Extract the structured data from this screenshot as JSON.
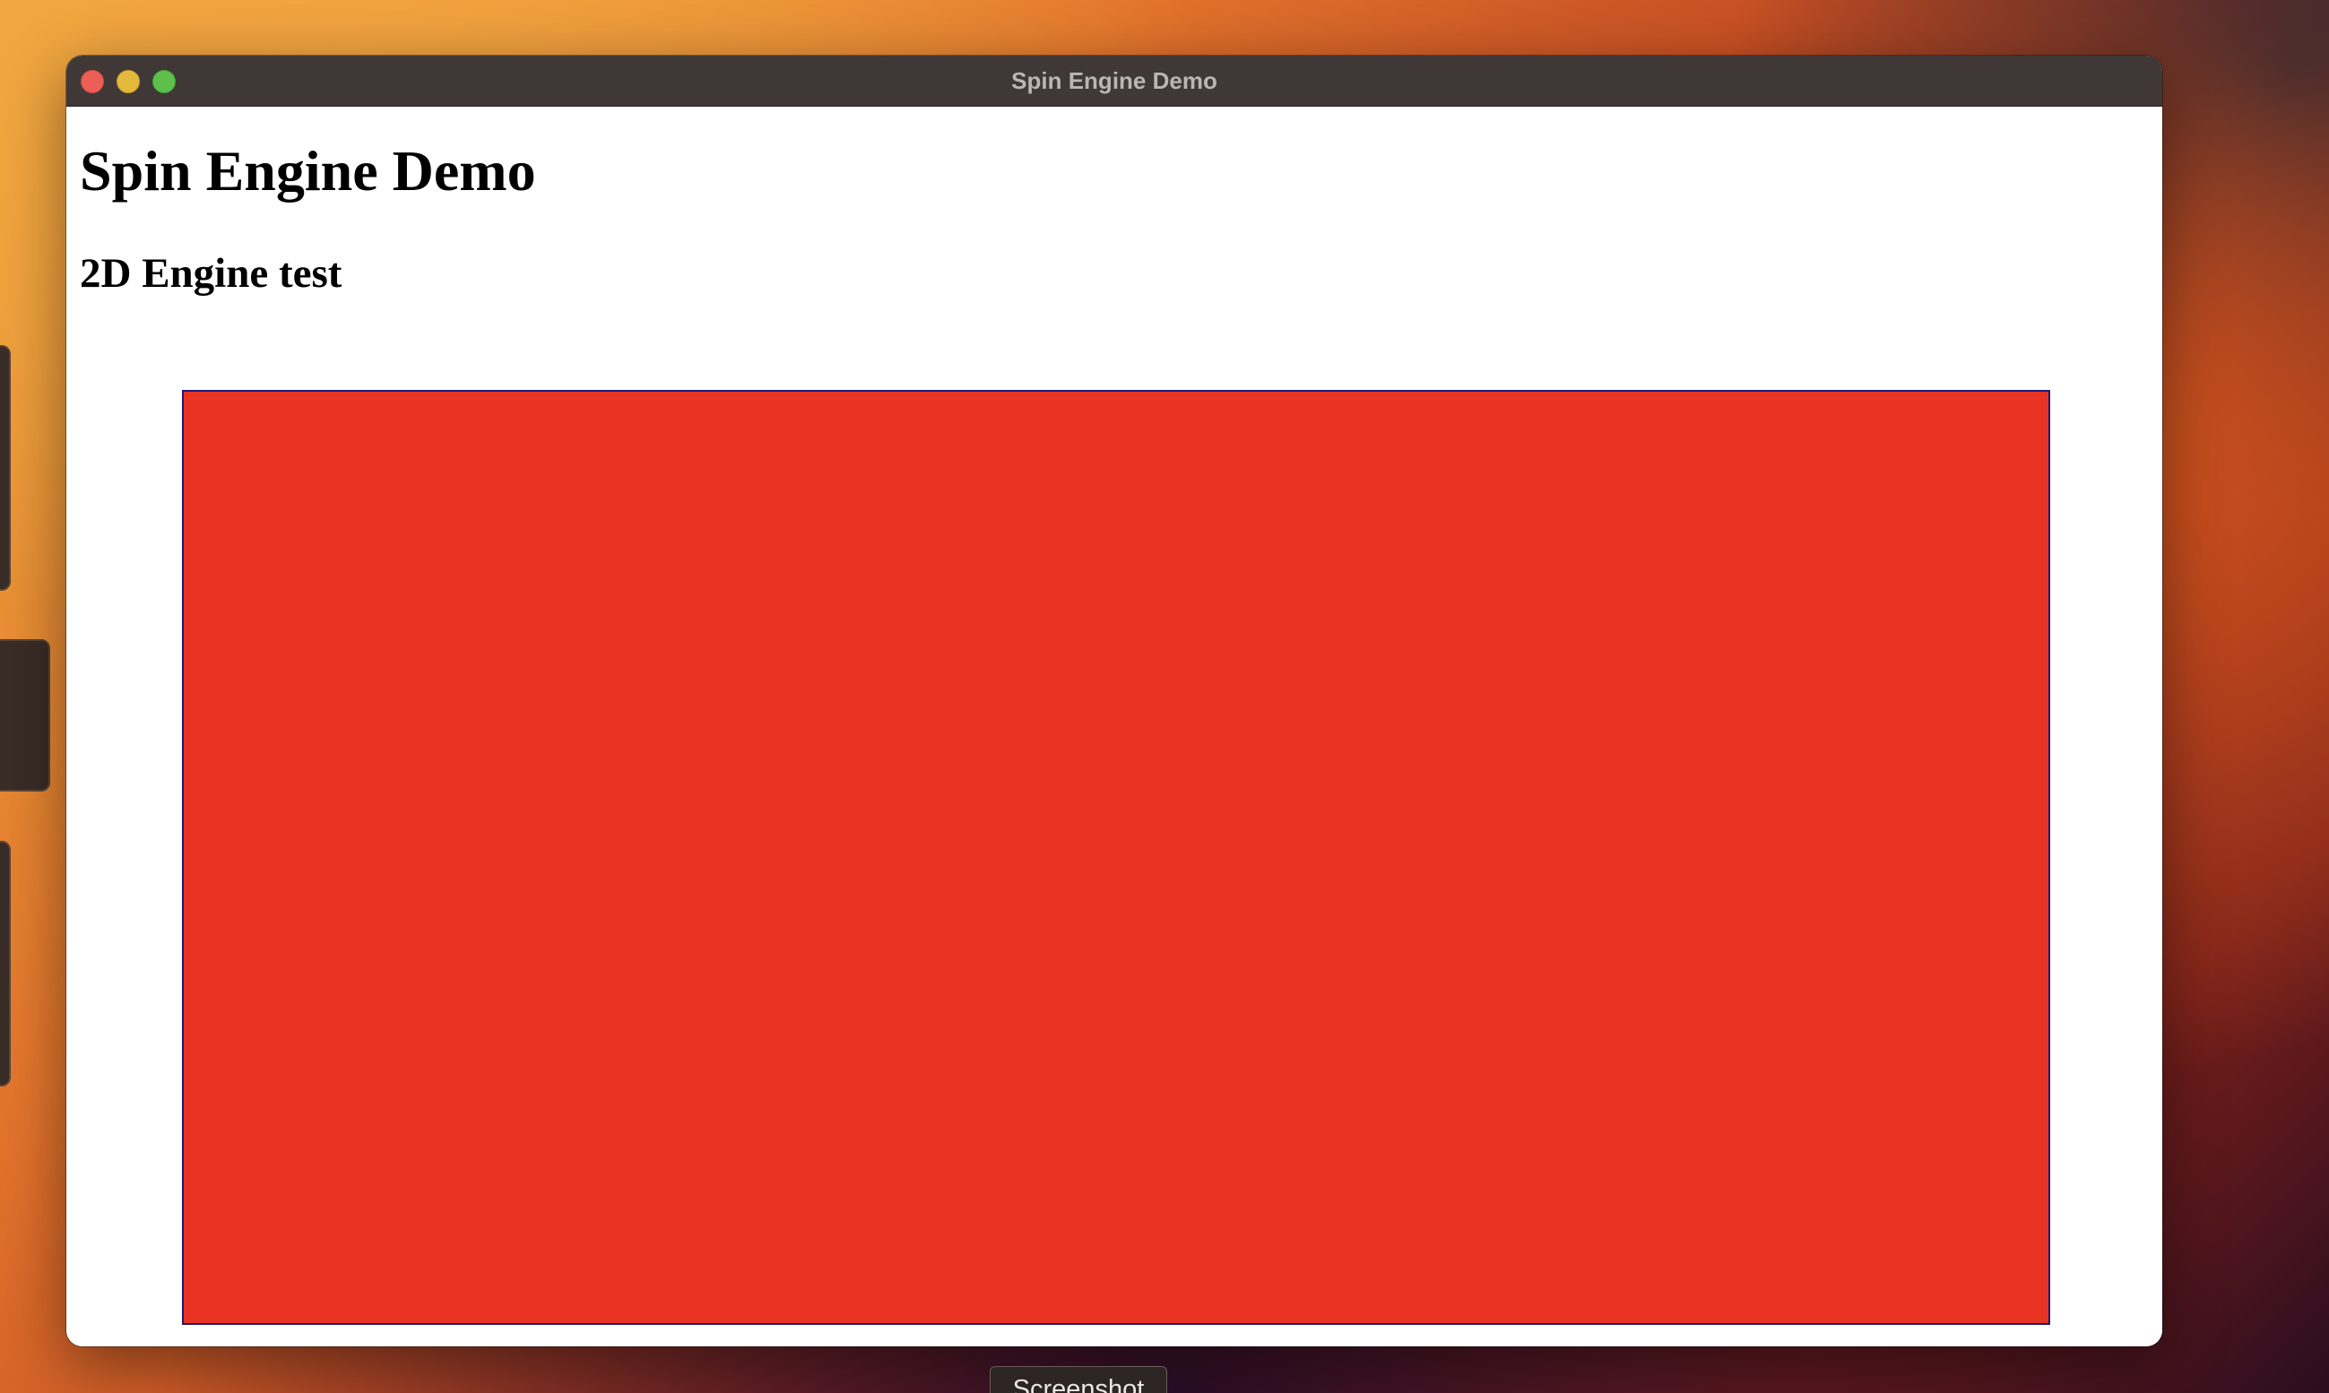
{
  "window": {
    "title": "Spin Engine Demo"
  },
  "page": {
    "heading": "Spin Engine Demo",
    "subheading": "2D Engine test"
  },
  "canvas": {
    "fill_color": "#e93423",
    "border_color": "#1a1a7a"
  },
  "overlay": {
    "screenshot_label": "Screenshot"
  },
  "icons": {
    "close": "close-icon",
    "minimize": "minimize-icon",
    "zoom": "zoom-icon"
  }
}
